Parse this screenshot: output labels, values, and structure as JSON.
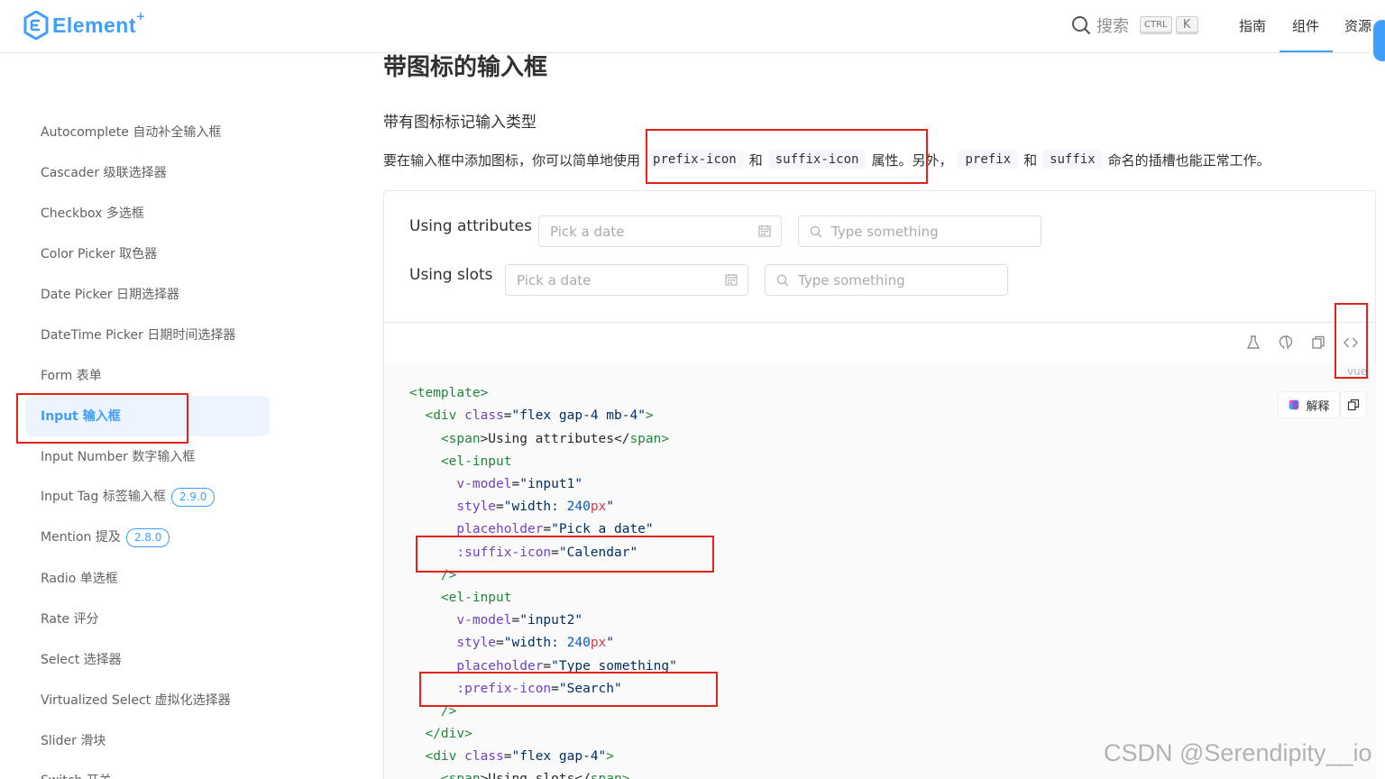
{
  "header": {
    "logo_text": "Element",
    "logo_plus": "+",
    "search_label": "搜索",
    "kbd_ctrl": "CTRL",
    "kbd_k": "K",
    "nav": {
      "guide": "指南",
      "components": "组件",
      "resources": "资源"
    }
  },
  "sidebar": {
    "items": [
      {
        "label": "Autocomplete 自动补全输入框"
      },
      {
        "label": "Cascader 级联选择器"
      },
      {
        "label": "Checkbox 多选框"
      },
      {
        "label": "Color Picker 取色器"
      },
      {
        "label": "Date Picker 日期选择器"
      },
      {
        "label": "DateTime Picker 日期时间选择器"
      },
      {
        "label": "Form 表单"
      },
      {
        "label": "Input 输入框",
        "active": true
      },
      {
        "label": "Input Number 数字输入框"
      },
      {
        "label": "Input Tag 标签输入框",
        "badge": "2.9.0"
      },
      {
        "label": "Mention 提及",
        "badge": "2.8.0"
      },
      {
        "label": "Radio 单选框"
      },
      {
        "label": "Rate 评分"
      },
      {
        "label": "Select 选择器"
      },
      {
        "label": "Virtualized Select 虚拟化选择器"
      },
      {
        "label": "Slider 滑块"
      },
      {
        "label": "Switch 开关"
      }
    ]
  },
  "main": {
    "title": "带图标的输入框",
    "subtitle": "带有图标标记输入类型",
    "desc": {
      "p1": "要在输入框中添加图标，你可以简单地使用",
      "code1": "prefix-icon",
      "and1": "和",
      "code2": "suffix-icon",
      "p2": "属性。另外，",
      "code3": "prefix",
      "and2": "和",
      "code4": "suffix",
      "p3": "命名的插槽也能正常工作。"
    },
    "demo": {
      "row1_label": "Using attributes",
      "row2_label": "Using slots",
      "date_placeholder": "Pick a date",
      "text_placeholder": "Type something"
    },
    "vue_tag": "vue",
    "ai_label": "解释"
  },
  "code": {
    "l1_tag": "<template>",
    "l2_open": "<div ",
    "l2_attr": "class",
    "l2_eq": "=",
    "l2_val": "\"flex gap-4 mb-4\"",
    "l2_close": ">",
    "l3_open": "<span",
    "l3_mid": ">Using attributes</",
    "l3_tag": "span",
    "l3_close": ">",
    "l4_tag": "<el-input",
    "l5_attr": "v-model",
    "l5_eq": "=",
    "l5_val": "\"input1\"",
    "l6_attr": "style",
    "l6_eq": "=",
    "l6_q1": "\"width: ",
    "l6_num": "240",
    "l6_unit": "px",
    "l6_q2": "\"",
    "l7_attr": "placeholder",
    "l7_eq": "=",
    "l7_val": "\"Pick a date\"",
    "l8_attr": ":suffix-icon",
    "l8_eq": "=",
    "l8_val": "\"Calendar\"",
    "l9": "/>",
    "l10_tag": "<el-input",
    "l11_attr": "v-model",
    "l11_eq": "=",
    "l11_val": "\"input2\"",
    "l12_attr": "style",
    "l12_eq": "=",
    "l12_q1": "\"width: ",
    "l12_num": "240",
    "l12_unit": "px",
    "l12_q2": "\"",
    "l13_attr": "placeholder",
    "l13_eq": "=",
    "l13_val": "\"Type something\"",
    "l14_attr": ":prefix-icon",
    "l14_eq": "=",
    "l14_val": "\"Search\"",
    "l15": "/>",
    "l16_tag": "</div>",
    "l17_open": "<div ",
    "l17_attr": "class",
    "l17_eq": "=",
    "l17_val": "\"flex gap-4\"",
    "l17_close": ">",
    "l18_open": "<span",
    "l18_mid": ">Using slots</",
    "l18_tag": "span",
    "l18_close": ">"
  },
  "watermark": "CSDN @Serendipity__io",
  "colors": {
    "accent": "#409eff",
    "annotation_red": "#e2231a"
  }
}
